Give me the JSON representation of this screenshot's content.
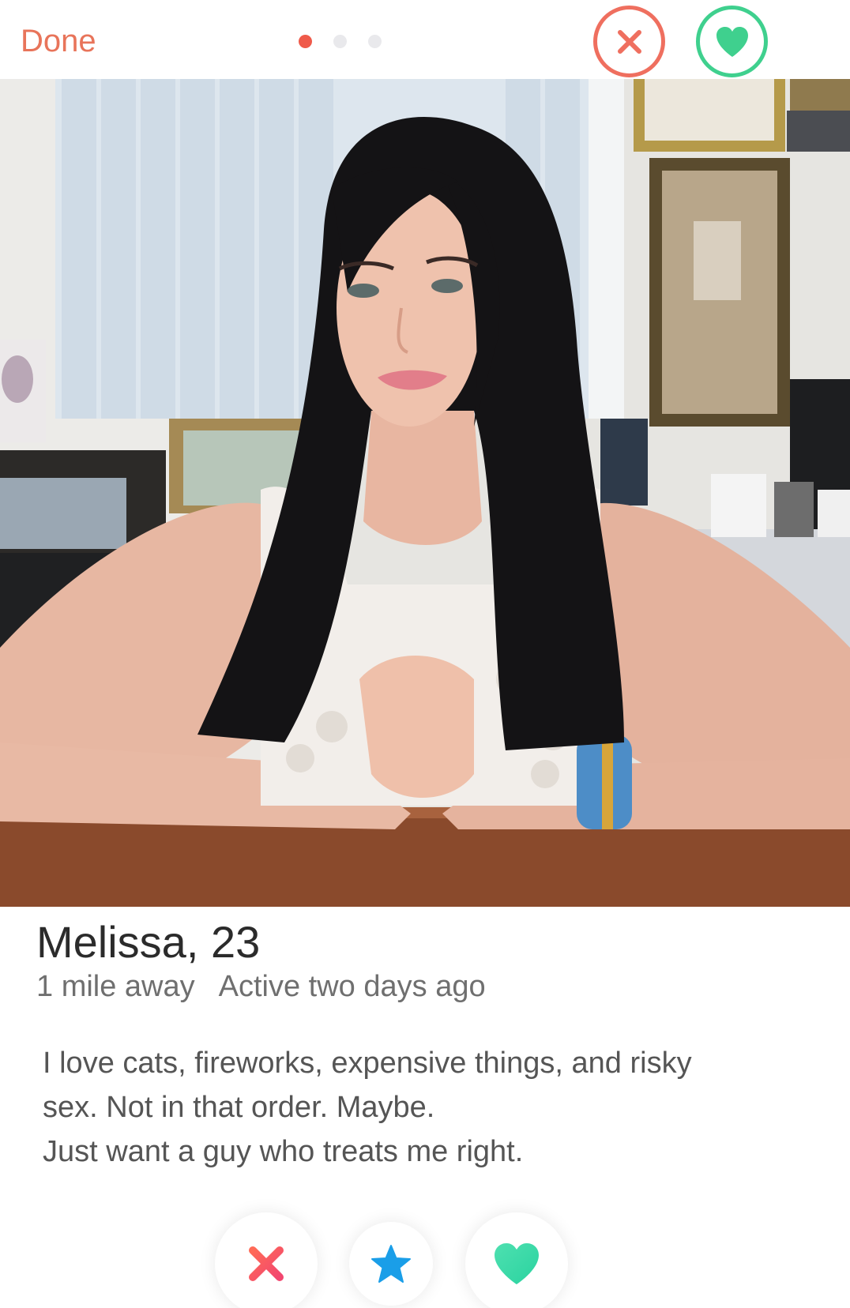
{
  "topbar": {
    "done_label": "Done",
    "page_count": 3,
    "active_page": 1,
    "actions": [
      "close-icon",
      "heart-icon"
    ]
  },
  "colors": {
    "done": "#e8745a",
    "nope": "#ef6f5f",
    "like": "#3fd08e",
    "star": "#1a9ee8",
    "active_dot": "#ef5a4a",
    "inactive_dot": "#e9e9ec"
  },
  "profile": {
    "name_age": "Melissa, 23",
    "distance": "1 mile away",
    "active": "Active two days ago",
    "bio_lines": [
      "I love cats, fireworks, expensive things, and risky",
      "sex. Not in that order. Maybe.",
      "Just want a guy who treats me right."
    ]
  },
  "bottom_actions": [
    "close-icon",
    "star-icon",
    "heart-icon"
  ]
}
